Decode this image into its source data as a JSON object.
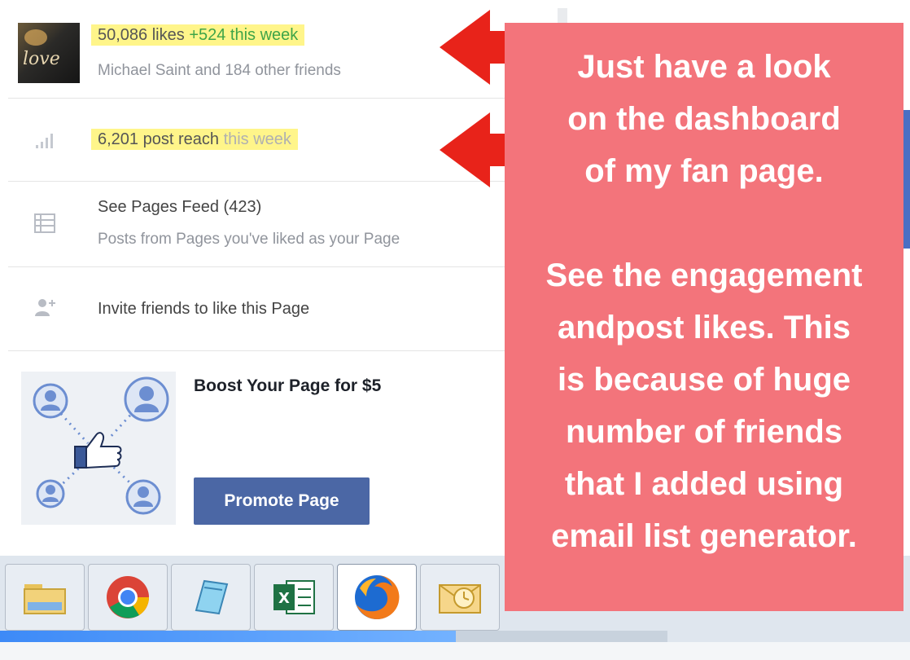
{
  "row1": {
    "likes": "50,086 likes",
    "likes_delta": "+524 this week",
    "friends": "Michael Saint and 184 other friends",
    "thumb_text": "love"
  },
  "row2": {
    "reach": "6,201 post reach",
    "period": "this week"
  },
  "row3": {
    "title": "See Pages Feed (423)",
    "subtitle": "Posts from Pages you've liked as your Page"
  },
  "row4": {
    "label": "Invite friends to like this Page"
  },
  "boost": {
    "title": "Boost Your Page for $5",
    "button": "Promote Page"
  },
  "overlay": {
    "text": "Just have a look\non the dashboard\nof my fan page.\n\nSee the engagement\nandpost likes. This\nis because of huge\nnumber of friends\nthat I added using\nemail list generator."
  },
  "colors": {
    "overlay": "#f3747b",
    "highlight": "#fff58a",
    "arrow": "#e8231a",
    "promote_button": "#4b67a5",
    "green_delta": "#3fa548"
  },
  "taskbar": {
    "apps": [
      "file-explorer-icon",
      "chrome-icon",
      "notepad-icon",
      "excel-icon",
      "firefox-icon",
      "outlook-icon"
    ]
  }
}
